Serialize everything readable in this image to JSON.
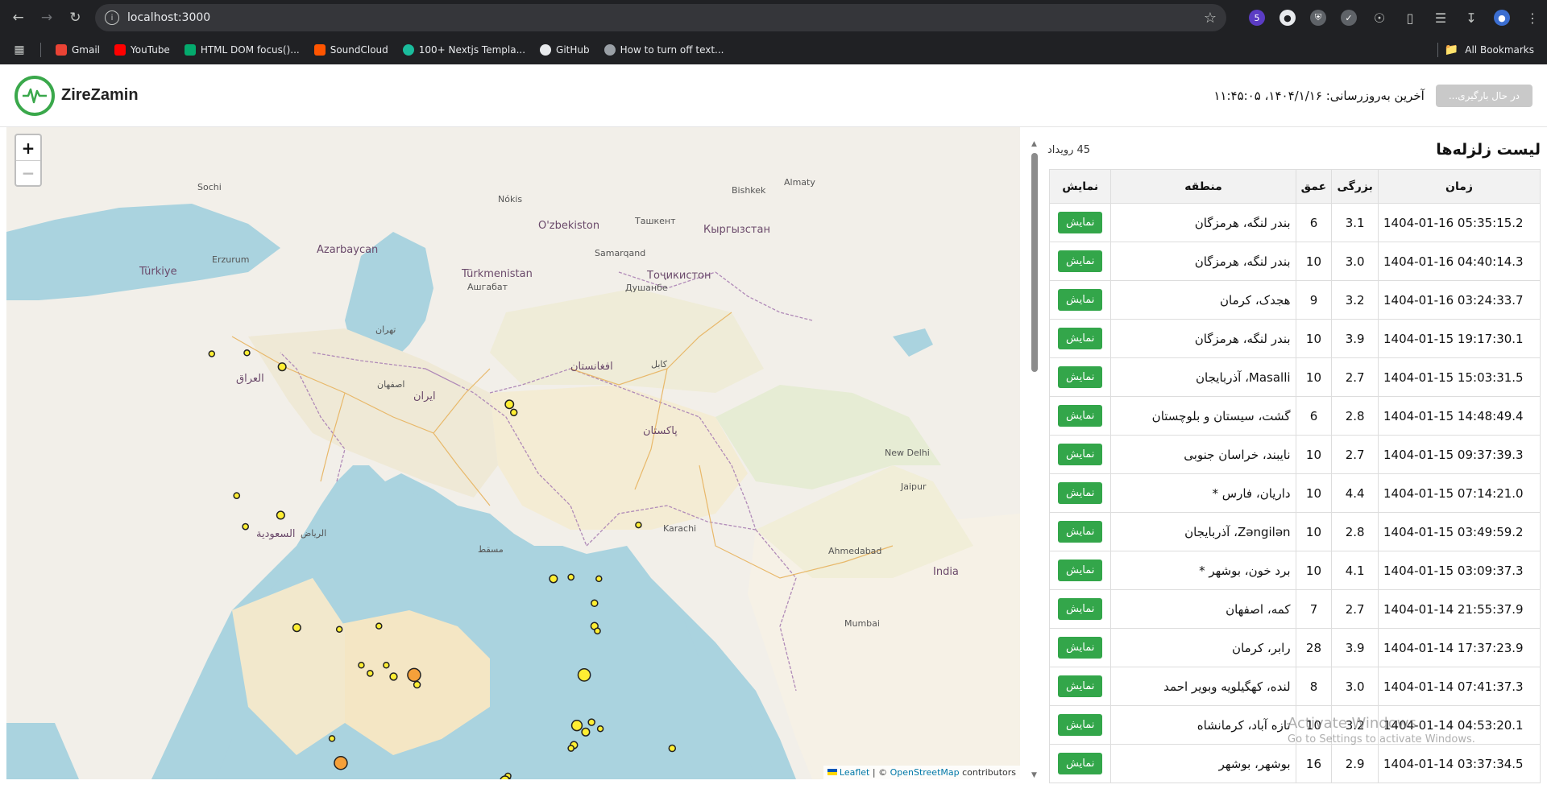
{
  "browser": {
    "url": "localhost:3000",
    "tab_count_badge": "5",
    "bookmarks": [
      {
        "label": "Gmail",
        "color": "#ea4335"
      },
      {
        "label": "YouTube",
        "color": "#ff0000"
      },
      {
        "label": "HTML DOM focus()...",
        "color": "#04aa6d"
      },
      {
        "label": "SoundCloud",
        "color": "#ff5500"
      },
      {
        "label": "100+ Nextjs Templa...",
        "color": "#1abc9c"
      },
      {
        "label": "GitHub",
        "color": "#e8eaed"
      },
      {
        "label": "How to turn off text...",
        "color": "#9aa0a6"
      }
    ],
    "all_bookmarks": "All Bookmarks"
  },
  "header": {
    "brand": "ZireZamin",
    "last_update": "آخرین به‌روزرسانی: ۱۴۰۴/۱/۱۶، ۱۱:۴۵:۰۵",
    "refresh_label": "در حال بارگیری..."
  },
  "map": {
    "zoom_in": "+",
    "zoom_out": "−",
    "attribution_leaflet": "Leaflet",
    "attribution_sep": " | © ",
    "attribution_osm": "OpenStreetMap",
    "attribution_tail": " contributors",
    "labels": [
      {
        "text": "Türkiye"
      },
      {
        "text": "Azarbaycan"
      },
      {
        "text": "Türkmenistan"
      },
      {
        "text": "O'zbekiston"
      },
      {
        "text": "Тоҷикистон"
      },
      {
        "text": "Кыргызстан"
      },
      {
        "text": "ایران"
      },
      {
        "text": "العراق"
      },
      {
        "text": "افغانستان"
      },
      {
        "text": "پاکستان"
      },
      {
        "text": "India"
      },
      {
        "text": "السعودية"
      },
      {
        "text": "Ашгабат"
      },
      {
        "text": "Душанбе"
      },
      {
        "text": "Samarqand"
      },
      {
        "text": "تهران"
      },
      {
        "text": "اصفهان"
      },
      {
        "text": "کابل"
      },
      {
        "text": "New Delhi"
      },
      {
        "text": "Karachi"
      },
      {
        "text": "مسقط"
      },
      {
        "text": "الرياض"
      },
      {
        "text": "Sochi"
      },
      {
        "text": "Erzurum"
      },
      {
        "text": "Mumbai"
      },
      {
        "text": "Ahmedabad"
      },
      {
        "text": "Jaipur"
      },
      {
        "text": "Nókis"
      },
      {
        "text": "Ташкент"
      },
      {
        "text": "Bishkek"
      },
      {
        "text": "Almaty"
      }
    ],
    "quakes": [
      {
        "lat": 38.55,
        "lon": 45.0,
        "mag": 2.8
      },
      {
        "lat": 38.58,
        "lon": 46.2,
        "mag": 2.7
      },
      {
        "lat": 38.15,
        "lon": 47.4,
        "mag": 3.2
      },
      {
        "lat": 37.0,
        "lon": 55.15,
        "mag": 3.3
      },
      {
        "lat": 36.75,
        "lon": 55.3,
        "mag": 3.0
      },
      {
        "lat": 34.2,
        "lon": 45.85,
        "mag": 2.9
      },
      {
        "lat": 33.6,
        "lon": 47.35,
        "mag": 3.2
      },
      {
        "lat": 33.25,
        "lon": 46.15,
        "mag": 2.9
      },
      {
        "lat": 33.3,
        "lon": 59.55,
        "mag": 2.7
      },
      {
        "lat": 31.65,
        "lon": 56.65,
        "mag": 3.2
      },
      {
        "lat": 31.7,
        "lon": 57.25,
        "mag": 2.9
      },
      {
        "lat": 31.65,
        "lon": 58.2,
        "mag": 2.8
      },
      {
        "lat": 30.9,
        "lon": 58.05,
        "mag": 3.0
      },
      {
        "lat": 30.15,
        "lon": 47.9,
        "mag": 3.2
      },
      {
        "lat": 30.1,
        "lon": 49.35,
        "mag": 2.8
      },
      {
        "lat": 30.2,
        "lon": 50.7,
        "mag": 2.6
      },
      {
        "lat": 30.2,
        "lon": 58.05,
        "mag": 3.1
      },
      {
        "lat": 30.05,
        "lon": 58.15,
        "mag": 2.9
      },
      {
        "lat": 29.0,
        "lon": 50.1,
        "mag": 2.7
      },
      {
        "lat": 28.75,
        "lon": 50.4,
        "mag": 2.9
      },
      {
        "lat": 29.0,
        "lon": 50.95,
        "mag": 2.7
      },
      {
        "lat": 28.65,
        "lon": 51.2,
        "mag": 3.1
      },
      {
        "lat": 28.7,
        "lon": 51.9,
        "mag": 4.4
      },
      {
        "lat": 28.4,
        "lon": 52.0,
        "mag": 3.0
      },
      {
        "lat": 28.7,
        "lon": 57.7,
        "mag": 3.9
      },
      {
        "lat": 27.15,
        "lon": 57.45,
        "mag": 3.6
      },
      {
        "lat": 27.25,
        "lon": 57.95,
        "mag": 3.0
      },
      {
        "lat": 26.95,
        "lon": 57.75,
        "mag": 3.2
      },
      {
        "lat": 27.05,
        "lon": 58.25,
        "mag": 2.8
      },
      {
        "lat": 26.55,
        "lon": 57.35,
        "mag": 3.1
      },
      {
        "lat": 26.45,
        "lon": 57.25,
        "mag": 2.9
      },
      {
        "lat": 26.45,
        "lon": 60.7,
        "mag": 3.0
      },
      {
        "lat": 26.75,
        "lon": 49.1,
        "mag": 2.7
      },
      {
        "lat": 26.0,
        "lon": 49.4,
        "mag": 4.1
      },
      {
        "lat": 25.6,
        "lon": 55.1,
        "mag": 2.9
      },
      {
        "lat": 25.45,
        "lon": 55.0,
        "mag": 3.5
      },
      {
        "lat": 25.4,
        "lon": 55.15,
        "mag": 3.0
      },
      {
        "lat": 24.35,
        "lon": 59.6,
        "mag": 2.7
      }
    ]
  },
  "list": {
    "title": "لیست زلزله‌ها",
    "count": "45 رویداد",
    "columns": [
      "زمان",
      "بزرگی",
      "عمق",
      "منطقه",
      "نمایش"
    ],
    "show_label": "نمایش",
    "rows": [
      {
        "time": "1404-01-16 05:35:15.2",
        "mag": "3.1",
        "depth": "6",
        "region": "بندر لنگه، هرمزگان"
      },
      {
        "time": "1404-01-16 04:40:14.3",
        "mag": "3.0",
        "depth": "10",
        "region": "بندر لنگه، هرمزگان"
      },
      {
        "time": "1404-01-16 03:24:33.7",
        "mag": "3.2",
        "depth": "9",
        "region": "هجدک، کرمان"
      },
      {
        "time": "1404-01-15 19:17:30.1",
        "mag": "3.9",
        "depth": "10",
        "region": "بندر لنگه، هرمزگان"
      },
      {
        "time": "1404-01-15 15:03:31.5",
        "mag": "2.7",
        "depth": "10",
        "region": "Masalli، آذربایجان"
      },
      {
        "time": "1404-01-15 14:48:49.4",
        "mag": "2.8",
        "depth": "6",
        "region": "گشت، سیستان و بلوچستان"
      },
      {
        "time": "1404-01-15 09:37:39.3",
        "mag": "2.7",
        "depth": "10",
        "region": "نایبند، خراسان جنوبی"
      },
      {
        "time": "1404-01-15 07:14:21.0",
        "mag": "4.4",
        "depth": "10",
        "region": "داریان، فارس *"
      },
      {
        "time": "1404-01-15 03:49:59.2",
        "mag": "2.8",
        "depth": "10",
        "region": "Zəngilən، آذربایجان"
      },
      {
        "time": "1404-01-15 03:09:37.3",
        "mag": "4.1",
        "depth": "10",
        "region": "برد خون، بوشهر *"
      },
      {
        "time": "1404-01-14 21:55:37.9",
        "mag": "2.7",
        "depth": "7",
        "region": "کمه، اصفهان"
      },
      {
        "time": "1404-01-14 17:37:23.9",
        "mag": "3.9",
        "depth": "28",
        "region": "رابر، کرمان"
      },
      {
        "time": "1404-01-14 07:41:37.3",
        "mag": "3.0",
        "depth": "8",
        "region": "لنده، کهگیلویه وبویر احمد"
      },
      {
        "time": "1404-01-14 04:53:20.1",
        "mag": "3.2",
        "depth": "10",
        "region": "تازه آباد، کرمانشاه"
      },
      {
        "time": "1404-01-14 03:37:34.5",
        "mag": "2.9",
        "depth": "16",
        "region": "بوشهر، بوشهر"
      }
    ]
  },
  "watermark": {
    "title": "Activate Windows",
    "subtitle": "Go to Settings to activate Windows."
  },
  "colors": {
    "brand_green": "#3aa84b",
    "button_green": "#33a64a",
    "quake_yellow": "#ffee33",
    "quake_orange": "#f5a03a",
    "water": "#aad3df"
  }
}
